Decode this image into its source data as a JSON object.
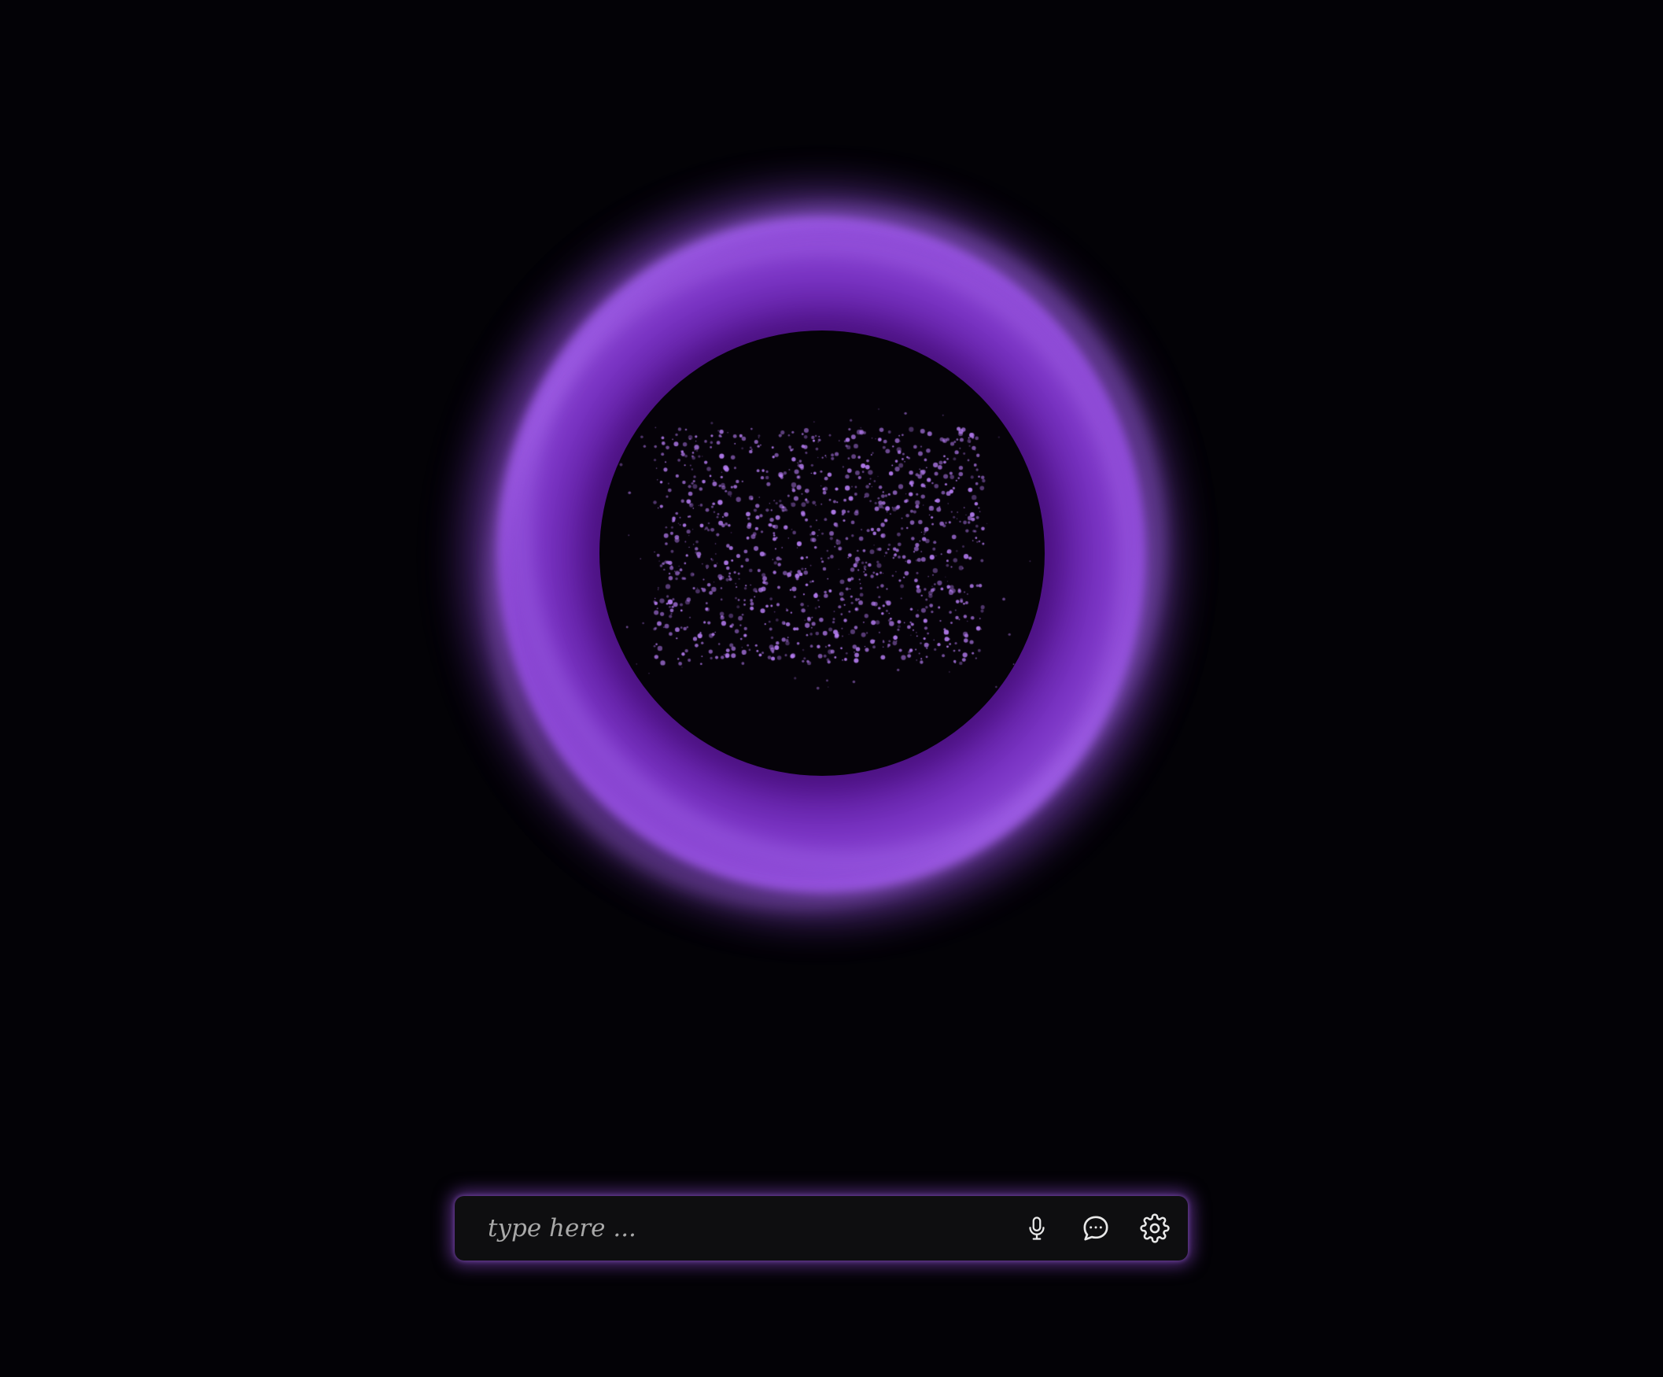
{
  "composer": {
    "placeholder": "type here ...",
    "value": "",
    "buttons": {
      "microphone": "microphone-icon",
      "chat": "chat-bubble-icon",
      "settings": "gear-icon"
    }
  },
  "theme": {
    "background": "#030206",
    "accent": "#9b55e0",
    "accent_dark": "#5b1a9b",
    "particle": "#b47cf0",
    "bar_background": "#0e0e10",
    "icon_color": "#e8e8e8"
  }
}
